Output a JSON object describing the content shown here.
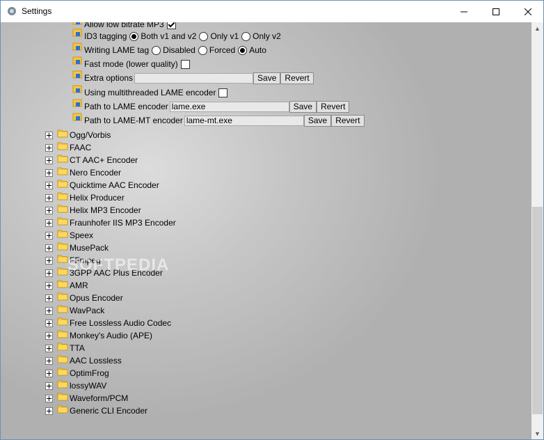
{
  "window": {
    "title": "Settings"
  },
  "options": {
    "low_bitrate": {
      "label": "Allow low bitrate MP3",
      "checked": true
    },
    "id3": {
      "label": "ID3 tagging",
      "choices": [
        "Both v1 and v2",
        "Only v1",
        "Only v2"
      ],
      "selected": "Both v1 and v2"
    },
    "lame_tag": {
      "label": "Writing LAME tag",
      "choices": [
        "Disabled",
        "Forced",
        "Auto"
      ],
      "selected": "Auto"
    },
    "fast_mode": {
      "label": "Fast mode (lower quality)",
      "checked": false
    },
    "extra_options": {
      "label": "Extra options",
      "value": ""
    },
    "multithreaded": {
      "label": "Using multithreaded LAME encoder",
      "checked": false
    },
    "lame_path": {
      "label": "Path to LAME encoder",
      "value": "lame.exe"
    },
    "lame_mt_path": {
      "label": "Path to LAME-MT encoder",
      "value": "lame-mt.exe"
    },
    "save_label": "Save",
    "revert_label": "Revert"
  },
  "encoders": [
    "Ogg/Vorbis",
    "FAAC",
    "CT AAC+ Encoder",
    "Nero Encoder",
    "Quicktime AAC Encoder",
    "Helix Producer",
    "Helix MP3 Encoder",
    "Fraunhofer IIS MP3 Encoder",
    "Speex",
    "MusePack",
    "FFmpeg",
    "3GPP AAC Plus Encoder",
    "AMR",
    "Opus Encoder",
    "WavPack",
    "Free Lossless Audio Codec",
    "Monkey's Audio (APE)",
    "TTA",
    "AAC Lossless",
    "OptimFrog",
    "lossyWAV",
    "Waveform/PCM",
    "Generic CLI Encoder"
  ],
  "watermark": "SOFTPEDIA",
  "colors": {
    "folder": "#f5c542",
    "folder_dark": "#c99a1d",
    "window_border": "#6c8fb3"
  }
}
